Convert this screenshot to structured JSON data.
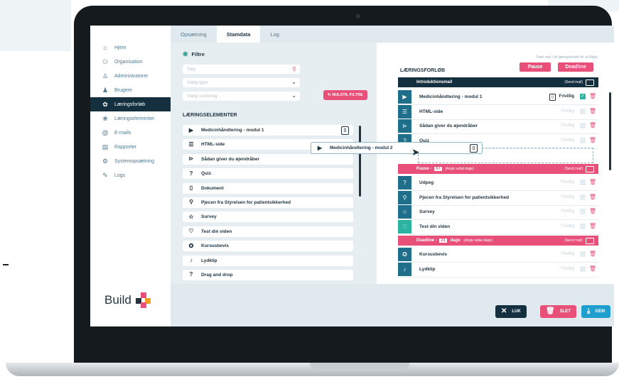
{
  "tabs": [
    "Opsætning",
    "Stamdata",
    "Log"
  ],
  "sidebar": {
    "items": [
      {
        "label": "Hjem",
        "icon": "home-icon",
        "glyph": "⌂"
      },
      {
        "label": "Organisation",
        "icon": "org-icon",
        "glyph": "⚇"
      },
      {
        "label": "Administratorer",
        "icon": "admin-icon",
        "glyph": "♙"
      },
      {
        "label": "Brugere",
        "icon": "users-icon",
        "glyph": "♟"
      },
      {
        "label": "Læringsforløb",
        "icon": "course-icon",
        "glyph": "✿"
      },
      {
        "label": "Læringselementer",
        "icon": "elements-icon",
        "glyph": "❀"
      },
      {
        "label": "E-mails",
        "icon": "email-icon",
        "glyph": "@"
      },
      {
        "label": "Rapporter",
        "icon": "reports-icon",
        "glyph": "▤"
      },
      {
        "label": "Systemopsætning",
        "icon": "settings-icon",
        "glyph": "⚙"
      },
      {
        "label": "Logs",
        "icon": "logs-icon",
        "glyph": "✎"
      }
    ],
    "active_index": 4,
    "brand": "Build"
  },
  "filter": {
    "title": "Filtre",
    "search_placeholder": "Søg",
    "type_placeholder": "Vælg type",
    "sort_placeholder": "Vælg sortering",
    "reset_label": "NULSTIL FILTRE"
  },
  "elements": {
    "title": "LÆRINGSELEMENTER",
    "items": [
      {
        "label": "Medicinhåndtering - modul 1",
        "icon": "video-icon",
        "glyph": "▶",
        "badge": true
      },
      {
        "label": "HTML-side",
        "icon": "html-icon",
        "glyph": "☰"
      },
      {
        "label": "Sådan giver du øjendråber",
        "icon": "play-icon",
        "glyph": "⊳"
      },
      {
        "label": "Quiz",
        "icon": "quiz-icon",
        "glyph": "?"
      },
      {
        "label": "Dokument",
        "icon": "document-icon",
        "glyph": "▯"
      },
      {
        "label": "Pjecen fra Styrelsen for patientsikkerhed",
        "icon": "link-icon",
        "glyph": "⚲"
      },
      {
        "label": "Survey",
        "icon": "star-icon",
        "glyph": "☆"
      },
      {
        "label": "Test din viden",
        "icon": "heart-icon",
        "glyph": "♡"
      },
      {
        "label": "Kursusbevis",
        "icon": "certificate-icon",
        "glyph": "✪"
      },
      {
        "label": "Lydklip",
        "icon": "audio-icon",
        "glyph": "♪"
      },
      {
        "label": "Drag and drop",
        "icon": "drag-icon",
        "glyph": "?"
      }
    ]
  },
  "drag_item": {
    "label": "Medicinhåndtering - modul 2",
    "glyph": "▶"
  },
  "course": {
    "hint": "Træk ned i dit læringsforløb for at tilføje",
    "title": "LÆRINGSFORLØB",
    "pause_label": "Pause",
    "deadline_label": "Deadline",
    "intro_label": "Introduktionsmail",
    "send_mail": "(Send mail)",
    "pause_section_label": "Pause -",
    "pause_days": "07",
    "pause_days_hint": "(Angiv antal dage)",
    "deadline_section_label": "Deadline -",
    "deadline_days": "21",
    "deadline_days_unit": "dage",
    "deadline_days_hint": "(Angiv antal dage)",
    "optional_label": "Frivillig",
    "rows1": [
      {
        "label": "Medicinhåndtering - modul 1",
        "glyph": "▶",
        "checked": true
      },
      {
        "label": "HTML-side",
        "glyph": "☰",
        "checked": false
      },
      {
        "label": "Sådan giver du øjendråber",
        "glyph": "⊳",
        "checked": false
      },
      {
        "label": "Quiz",
        "glyph": "?",
        "checked": false
      }
    ],
    "rows2": [
      {
        "label": "Udpeg",
        "glyph": "?",
        "checked": false
      },
      {
        "label": "Pjecen fra Styrelsen for patientsikkerhed",
        "glyph": "⚲",
        "checked": false
      },
      {
        "label": "Survey",
        "glyph": "☆",
        "checked": false
      },
      {
        "label": "Test din viden",
        "glyph": "♡",
        "checked": false,
        "green": true
      }
    ],
    "rows3": [
      {
        "label": "Kursusbevis",
        "glyph": "✪",
        "checked": false
      },
      {
        "label": "Lydklip",
        "glyph": "♪",
        "checked": false
      }
    ]
  },
  "buttons": {
    "close": "LUK",
    "delete": "SLET",
    "save": "GEM"
  },
  "colors": {
    "navy": "#14303f",
    "pink": "#e8507a",
    "teal": "#1f6f8b",
    "green": "#2ab3a0"
  }
}
